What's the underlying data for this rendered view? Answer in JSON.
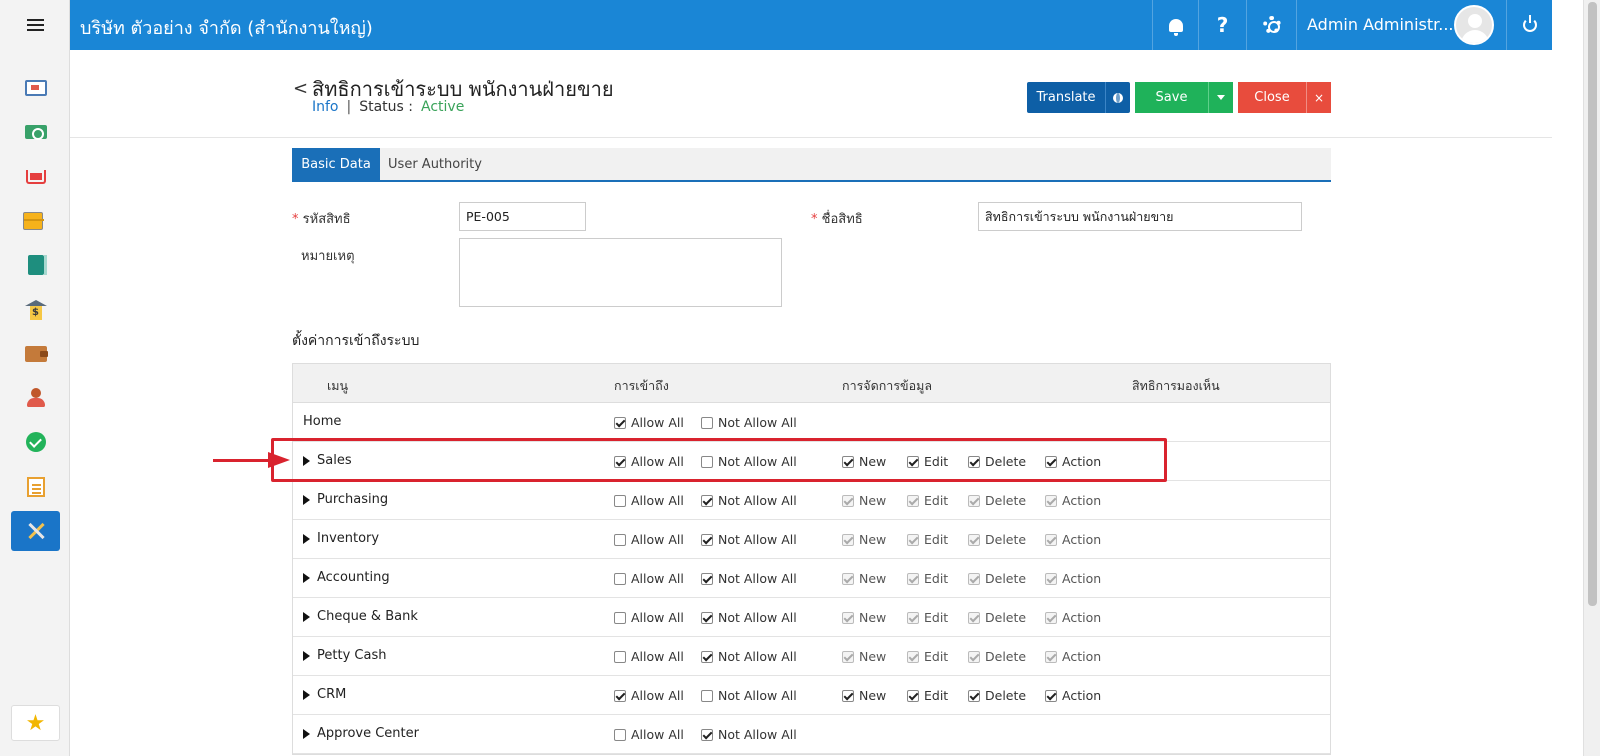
{
  "topbar": {
    "company": "บริษัท ตัวอย่าง จำกัด (สำนักงานใหญ่)",
    "help": "?",
    "user_name": "Admin Administr..."
  },
  "sidebar": {
    "items": [
      {
        "icon": "monitor-icon"
      },
      {
        "icon": "money-icon"
      },
      {
        "icon": "cart-icon"
      },
      {
        "icon": "box-icon"
      },
      {
        "icon": "book-icon"
      },
      {
        "icon": "bank-icon"
      },
      {
        "icon": "wallet-icon"
      },
      {
        "icon": "person-icon"
      },
      {
        "icon": "check-icon"
      },
      {
        "icon": "document-icon"
      },
      {
        "icon": "tools-icon",
        "active": true
      }
    ],
    "favorite_icon": "star-icon",
    "favorite_glyph": "★"
  },
  "header": {
    "back": "<",
    "title": "สิทธิการเข้าระบบ พนักงานฝ่ายขาย",
    "info_link": "Info",
    "separator": "|",
    "status_label": "Status  :",
    "status_value": "Active"
  },
  "actions": {
    "translate": "Translate",
    "save": "Save",
    "close": "Close",
    "close_x": "×"
  },
  "tabs": [
    {
      "label": "Basic Data",
      "active": true
    },
    {
      "label": "User Authority",
      "active": false
    }
  ],
  "form": {
    "required_mark": "*",
    "code_label": "รหัสสิทธิ",
    "code_value": "PE-005",
    "name_label": "ชื่อสิทธิ",
    "name_value": "สิทธิการเข้าระบบ พนักงานฝ่ายขาย",
    "note_label": "หมายเหตุ",
    "note_value": ""
  },
  "access_section": {
    "title": "ตั้งค่าการเข้าถึงระบบ",
    "columns": [
      "เมนู",
      "การเข้าถึง",
      "การจัดการข้อมูล",
      "สิทธิการมองเห็น"
    ],
    "labels": {
      "allow_all": "Allow All",
      "not_allow_all": "Not Allow All",
      "new": "New",
      "edit": "Edit",
      "delete": "Delete",
      "action": "Action"
    },
    "rows": [
      {
        "menu": "Home",
        "expandable": false,
        "allow_all": true,
        "not_allow_all": false,
        "has_manage": false
      },
      {
        "menu": "Sales",
        "expandable": true,
        "allow_all": true,
        "not_allow_all": false,
        "has_manage": true,
        "manage_enabled": true,
        "new": true,
        "edit": true,
        "delete": true,
        "action": true
      },
      {
        "menu": "Purchasing",
        "expandable": true,
        "allow_all": false,
        "not_allow_all": true,
        "has_manage": true,
        "manage_enabled": false,
        "new": true,
        "edit": true,
        "delete": true,
        "action": true
      },
      {
        "menu": "Inventory",
        "expandable": true,
        "allow_all": false,
        "not_allow_all": true,
        "has_manage": true,
        "manage_enabled": false,
        "new": true,
        "edit": true,
        "delete": true,
        "action": true
      },
      {
        "menu": "Accounting",
        "expandable": true,
        "allow_all": false,
        "not_allow_all": true,
        "has_manage": true,
        "manage_enabled": false,
        "new": true,
        "edit": true,
        "delete": true,
        "action": true
      },
      {
        "menu": "Cheque & Bank",
        "expandable": true,
        "allow_all": false,
        "not_allow_all": true,
        "has_manage": true,
        "manage_enabled": false,
        "new": true,
        "edit": true,
        "delete": true,
        "action": true
      },
      {
        "menu": "Petty Cash",
        "expandable": true,
        "allow_all": false,
        "not_allow_all": true,
        "has_manage": true,
        "manage_enabled": false,
        "new": true,
        "edit": true,
        "delete": true,
        "action": true
      },
      {
        "menu": "CRM",
        "expandable": true,
        "allow_all": true,
        "not_allow_all": false,
        "has_manage": true,
        "manage_enabled": true,
        "new": true,
        "edit": true,
        "delete": true,
        "action": true
      },
      {
        "menu": "Approve Center",
        "expandable": true,
        "allow_all": false,
        "not_allow_all": true,
        "has_manage": false
      }
    ]
  },
  "annotation": {
    "highlight_color": "#d9232e"
  },
  "colors": {
    "topbar": "#1a86d6",
    "tab_active": "#1a6fb8",
    "translate": "#0e5fa6",
    "save": "#1fb25a",
    "close": "#e84c3d",
    "status_active": "#3aa35a"
  }
}
